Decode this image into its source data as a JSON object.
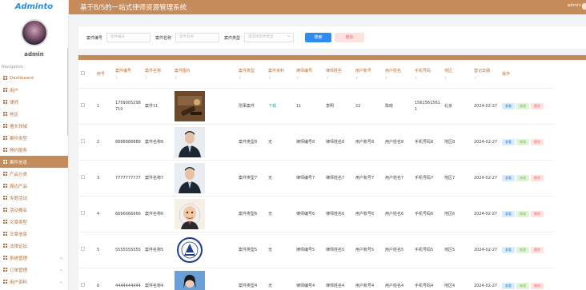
{
  "sidebar": {
    "brand": "Adminto",
    "admin_name": "admin",
    "nav_title": "Navigation",
    "items": [
      {
        "label": "Dashboard",
        "icon": "dashboard-icon",
        "active": false
      },
      {
        "label": "用户",
        "icon": "grid-icon",
        "active": false
      },
      {
        "label": "律师",
        "icon": "grid-icon",
        "active": false
      },
      {
        "label": "地区",
        "icon": "grid-icon",
        "active": false
      },
      {
        "label": "擅长领域",
        "icon": "grid-icon",
        "active": false
      },
      {
        "label": "案件类型",
        "icon": "grid-icon",
        "active": false
      },
      {
        "label": "预约服务",
        "icon": "grid-icon",
        "active": false
      },
      {
        "label": "案件信息",
        "icon": "grid-icon",
        "active": true
      },
      {
        "label": "产品分类",
        "icon": "tag-icon",
        "active": false
      },
      {
        "label": "周边产品",
        "icon": "grid-icon",
        "active": false
      },
      {
        "label": "专题活动",
        "icon": "grid-icon",
        "active": false,
        "hover": true
      },
      {
        "label": "活动报名",
        "icon": "grid-icon",
        "active": false
      },
      {
        "label": "文章类型",
        "icon": "grid-icon",
        "active": false
      },
      {
        "label": "文章信息",
        "icon": "grid-icon",
        "active": false
      },
      {
        "label": "法律论坛",
        "icon": "grid-icon",
        "active": false
      },
      {
        "label": "系统管理",
        "icon": "grid-icon",
        "active": false,
        "expandable": true
      },
      {
        "label": "订单管理",
        "icon": "grid-icon",
        "active": false,
        "expandable": true
      },
      {
        "label": "用户资料",
        "icon": "grid-icon",
        "active": false,
        "expandable": true
      }
    ]
  },
  "header": {
    "title": "基于B/S的一站式律师资源管理系统",
    "user": "admin"
  },
  "search": {
    "case_no_label": "案件编号",
    "case_no_placeholder": "案件编号",
    "case_name_label": "案件名称",
    "case_name_placeholder": "案件名称",
    "case_type_label": "案件类型",
    "case_type_placeholder": "请选择案件类型",
    "search_button": "搜索",
    "delete_button": "删除"
  },
  "table": {
    "columns": [
      "",
      "序号",
      "案件编号",
      "案件名称",
      "案件图片",
      "案件类型",
      "案件资料",
      "律师编号",
      "律师姓名",
      "用户账号",
      "用户姓名",
      "手机号码",
      "地区",
      "登记日期",
      "操作"
    ],
    "sort_mark": "⇕",
    "actions": {
      "view": "查看",
      "edit": "修改",
      "delete": "删除"
    },
    "rows": [
      {
        "no": "1",
        "code": "1709005298710",
        "name": "案件11",
        "image": "gavel",
        "type": "刑事案件",
        "material": "下载",
        "lawyer_no": "11",
        "lawyer_name": "李明",
        "account": "22",
        "user_name": "陈晓",
        "phone": "15615615611",
        "region": "北京",
        "date": "2024-02-27"
      },
      {
        "no": "2",
        "code": "8888888888",
        "name": "案件名称8",
        "image": "man1",
        "type": "案件类型8",
        "material": "无",
        "lawyer_no": "律师编号8",
        "lawyer_name": "律师姓名8",
        "account": "用户账号8",
        "user_name": "用户姓名8",
        "phone": "手机号码8",
        "region": "地区8",
        "date": "2024-02-27"
      },
      {
        "no": "3",
        "code": "7777777777",
        "name": "案件名称7",
        "image": "man2",
        "type": "案件类型7",
        "material": "无",
        "lawyer_no": "律师编号7",
        "lawyer_name": "律师姓名7",
        "account": "用户账号7",
        "user_name": "用户姓名7",
        "phone": "手机号码7",
        "region": "地区7",
        "date": "2024-02-27"
      },
      {
        "no": "4",
        "code": "6666666666",
        "name": "案件名称6",
        "image": "cartoon",
        "type": "案件类型6",
        "material": "无",
        "lawyer_no": "律师编号6",
        "lawyer_name": "律师姓名6",
        "account": "用户账号6",
        "user_name": "用户姓名6",
        "phone": "手机号码6",
        "region": "地区6",
        "date": "2024-02-27"
      },
      {
        "no": "5",
        "code": "5555555555",
        "name": "案件名称5",
        "image": "emblem",
        "type": "案件类型5",
        "material": "无",
        "lawyer_no": "律师编号5",
        "lawyer_name": "律师姓名5",
        "account": "用户账号5",
        "user_name": "用户姓名5",
        "phone": "手机号码5",
        "region": "地区5",
        "date": "2024-02-27"
      },
      {
        "no": "6",
        "code": "4444444444",
        "name": "案件名称4",
        "image": "woman",
        "type": "案件类型4",
        "material": "无",
        "lawyer_no": "律师编号4",
        "lawyer_name": "律师姓名4",
        "account": "用户账号4",
        "user_name": "用户姓名4",
        "phone": "手机号码4",
        "region": "地区4",
        "date": "2024-02-27"
      }
    ]
  },
  "colors": {
    "brand": "#c58b5b",
    "primary": "#2d8cf0",
    "danger": "#f56c6c"
  }
}
